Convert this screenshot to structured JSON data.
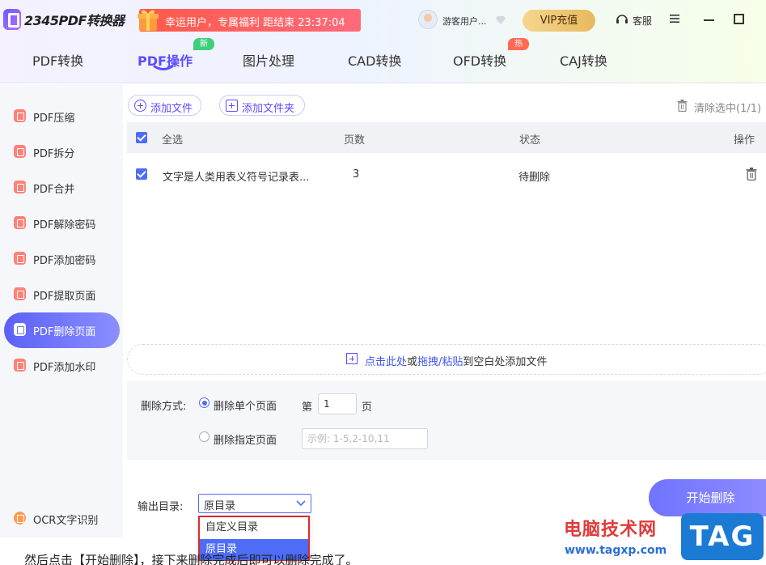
{
  "app": {
    "logo_text": "2345PDF转换器",
    "promo_text": "幸运用户，专属福利 距结束 23:37:04",
    "username": "游客用户...",
    "vip_label": "VIP充值",
    "service_label": "客服"
  },
  "nav": {
    "tabs": [
      {
        "label": "PDF转换"
      },
      {
        "label": "PDF操作",
        "badge": "新"
      },
      {
        "label": "图片处理"
      },
      {
        "label": "CAD转换"
      },
      {
        "label": "OFD转换",
        "badge": "热"
      },
      {
        "label": "CAJ转换"
      }
    ],
    "active_index": 1
  },
  "sidebar": {
    "items": [
      {
        "label": "PDF压缩"
      },
      {
        "label": "PDF拆分"
      },
      {
        "label": "PDF合并"
      },
      {
        "label": "PDF解除密码"
      },
      {
        "label": "PDF添加密码"
      },
      {
        "label": "PDF提取页面"
      },
      {
        "label": "PDF删除页面"
      },
      {
        "label": "PDF添加水印"
      }
    ],
    "active_index": 6,
    "ocr_label": "OCR文字识别"
  },
  "toolbar": {
    "add_file": "添加文件",
    "add_folder": "添加文件夹",
    "clear_selected": "清除选中(1/1)"
  },
  "table": {
    "headers": {
      "select_all": "全选",
      "pages": "页数",
      "status": "状态",
      "actions": "操作"
    },
    "rows": [
      {
        "name": "文字是人类用表义符号记录表...",
        "pages": "3",
        "status": "待删除",
        "checked": true
      }
    ]
  },
  "drop_zone": {
    "click_here": "点击此处",
    "or": "或",
    "drag_paste": "拖拽/粘贴",
    "suffix": "到空白处添加文件"
  },
  "delete_options": {
    "label": "删除方式:",
    "single_page": "删除单个页面",
    "page_prefix": "第",
    "page_value": "1",
    "page_suffix": "页",
    "specific_pages": "删除指定页面",
    "specific_placeholder": "示例: 1-5,2-10,11"
  },
  "output": {
    "label": "输出目录:",
    "selected": "原目录",
    "options": [
      "自定义目录",
      "原目录"
    ],
    "selected_index": 1
  },
  "start_button": "开始删除",
  "caption": "然后点击【开始删除】，接下来删除完成后即可以删除完成了。",
  "watermark": {
    "site_name": "电脑技术网",
    "url": "www.tagxp.com",
    "tag": "TAG"
  },
  "colors": {
    "accent": "#5b4cff",
    "selection": "#4f6cf7",
    "promo": "#ff5a4a",
    "highlight_border": "#e02a2a"
  }
}
